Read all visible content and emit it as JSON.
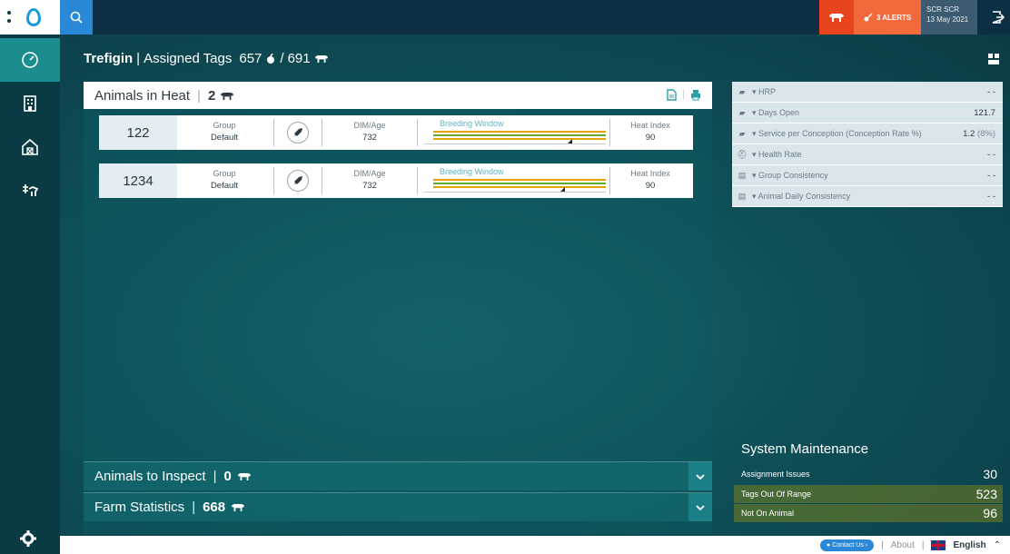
{
  "topbar": {
    "alerts_label": "3 ALERTS",
    "user_name": "SCR SCR",
    "user_date": "13 May 2021"
  },
  "header": {
    "farm": "Trefigin",
    "title": "Assigned Tags",
    "assigned": "657",
    "total": "691"
  },
  "heat": {
    "title": "Animals in Heat",
    "count": "2",
    "rows": [
      {
        "id": "122",
        "group_label": "Group",
        "group": "Default",
        "dim_label": "DIM/Age",
        "dim": "732",
        "bw_label": "Breeding Window",
        "hi_label": "Heat Index",
        "hi": "90"
      },
      {
        "id": "1234",
        "group_label": "Group",
        "group": "Default",
        "dim_label": "DIM/Age",
        "dim": "732",
        "bw_label": "Breeding Window",
        "hi_label": "Heat Index",
        "hi": "90"
      }
    ]
  },
  "inspect": {
    "title": "Animals to Inspect",
    "count": "0"
  },
  "farmstats": {
    "title": "Farm Statistics",
    "count": "668"
  },
  "metrics": [
    {
      "icon": "cow-icon",
      "label": "HRP",
      "value": "- -"
    },
    {
      "icon": "cow-icon",
      "label": "Days Open",
      "value": "121.7"
    },
    {
      "icon": "cow-icon",
      "label": "Service per Conception (Conception Rate %)",
      "value": "1.2",
      "sub": "(8%)"
    },
    {
      "icon": "health-icon",
      "label": "Health Rate",
      "value": "- -"
    },
    {
      "icon": "group-icon",
      "label": "Group Consistency",
      "value": "- -"
    },
    {
      "icon": "group-icon",
      "label": "Animal Daily Consistency",
      "value": "- -"
    }
  ],
  "system": {
    "title": "System Maintenance",
    "rows": [
      {
        "label": "Assignment Issues",
        "value": "30"
      },
      {
        "label": "Tags Out Of Range",
        "value": "523"
      },
      {
        "label": "Not On Animal",
        "value": "96"
      }
    ]
  },
  "footer": {
    "contact": "Contact Us",
    "about": "About",
    "language": "English"
  },
  "colors": {
    "accent": "#2a88d8",
    "alert": "#f26a3c",
    "nav_active": "#1b8d8f"
  }
}
